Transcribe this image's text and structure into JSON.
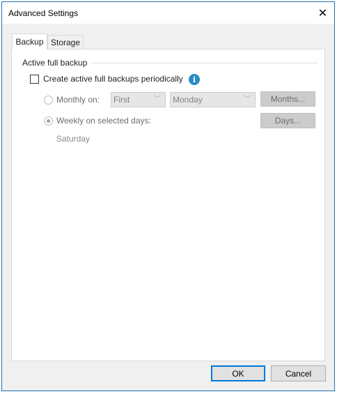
{
  "window": {
    "title": "Advanced Settings",
    "close_glyph": "✕"
  },
  "tabs": [
    {
      "label": "Backup",
      "active": true
    },
    {
      "label": "Storage",
      "active": false
    }
  ],
  "active_full_backup": {
    "group_label": "Active full backup",
    "checkbox_label": "Create active full backups periodically",
    "checkbox_checked": false,
    "info_glyph": "i",
    "monthly": {
      "label": "Monthly on:",
      "selected": false,
      "week_select": "First",
      "day_select": "Monday",
      "button": "Months..."
    },
    "weekly": {
      "label": "Weekly on selected days:",
      "selected": true,
      "button": "Days...",
      "days_summary": "Saturday"
    }
  },
  "footer": {
    "ok_label": "OK",
    "cancel_label": "Cancel"
  },
  "icons": {
    "info": "info-icon",
    "chevron": "chevron-down-icon",
    "close": "close-icon"
  },
  "colors": {
    "accent": "#0078d7",
    "info": "#2a8bc6",
    "window_border": "#1b6fb5"
  }
}
